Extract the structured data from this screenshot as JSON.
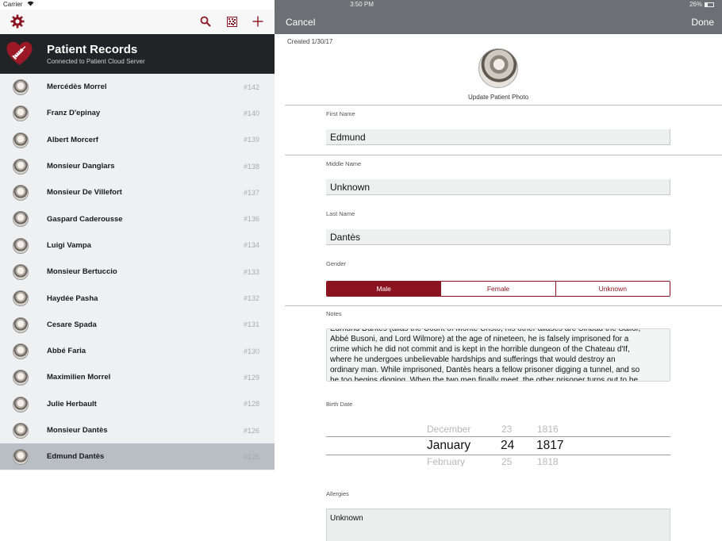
{
  "status": {
    "carrier": "Carrier",
    "time": "3:50 PM",
    "battery": "26%"
  },
  "colors": {
    "accent": "#8c1420",
    "header_bg": "#222327",
    "navbar_bg": "#6d6f74",
    "list_bg": "#eef0f2",
    "selected_bg": "#b9bec4"
  },
  "toolbar": {
    "icons": [
      "gear-icon",
      "search-icon",
      "qr-code-icon",
      "plus-icon"
    ]
  },
  "header": {
    "title": "Patient Records",
    "subtitle": "Connected to Patient Cloud Server",
    "logo_icon": "heart-syringe-icon"
  },
  "patients": [
    {
      "name": "Mercédès Morrel",
      "number": "#142"
    },
    {
      "name": "Franz D'epinay",
      "number": "#140"
    },
    {
      "name": "Albert Morcerf",
      "number": "#139"
    },
    {
      "name": "Monsieur Danglars",
      "number": "#138"
    },
    {
      "name": "Monsieur De Villefort",
      "number": "#137"
    },
    {
      "name": "Gaspard Caderousse",
      "number": "#136"
    },
    {
      "name": "Luigi Vampa",
      "number": "#134"
    },
    {
      "name": "Monsieur  Bertuccio",
      "number": "#133"
    },
    {
      "name": "Haydée Pasha",
      "number": "#132"
    },
    {
      "name": "Cesare Spada",
      "number": "#131"
    },
    {
      "name": "Abbé Faria",
      "number": "#130"
    },
    {
      "name": "Maximilien Morrel",
      "number": "#129"
    },
    {
      "name": "Julie Herbault",
      "number": "#128"
    },
    {
      "name": "Monsieur Dantès",
      "number": "#126"
    },
    {
      "name": "Edmund Dantès",
      "number": "#125",
      "selected": true
    }
  ],
  "form": {
    "cancel_label": "Cancel",
    "done_label": "Done",
    "created": "Created 1/30/17",
    "photo_label": "Update Patient Photo",
    "first_name_label": "First Name",
    "first_name": "Edmund",
    "middle_name_label": "Middle Name",
    "middle_name": "Unknown",
    "last_name_label": "Last Name",
    "last_name": "Dantès",
    "gender_label": "Gender",
    "gender_options": [
      "Male",
      "Female",
      "Unknown"
    ],
    "gender_selected": "Male",
    "notes_label": "Notes",
    "notes_lines": [
      "Edmund Dantès (alias the Count of Monte Cristo, his other aliases are Sinbad the Sailor,",
      "Abbé Busoni, and Lord Wilmore) at the age of nineteen, he is falsely imprisoned for a",
      "crime which he did not commit and is kept in the horrible dungeon of the Chateau d'If,",
      "where he undergoes unbelievable hardships and sufferings that would destroy an",
      "ordinary man. While imprisoned, Dantès hears a fellow prisoner digging a tunnel, and so",
      "he too begins digging. When the two men finally meet, the other prisoner turns out to be"
    ],
    "birth_date_label": "Birth Date",
    "birth_month_prev": "December",
    "birth_month": "January",
    "birth_month_next": "February",
    "birth_day_prev": "23",
    "birth_day": "24",
    "birth_day_next": "25",
    "birth_year_prev": "1816",
    "birth_year": "1817",
    "birth_year_next": "1818",
    "allergies_label": "Allergies",
    "allergies": "Unknown"
  }
}
